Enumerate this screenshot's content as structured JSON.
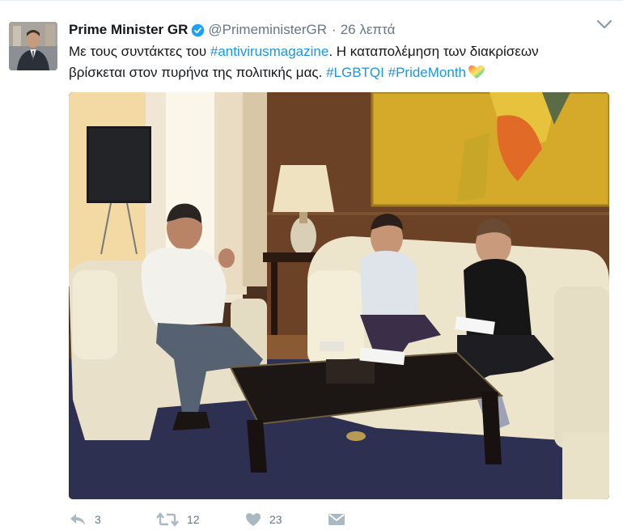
{
  "tweet": {
    "display_name": "Prime Minister GR",
    "handle": "@PrimeministerGR",
    "separator": "·",
    "time": "26 λεπτά",
    "text_line1_prefix": "Με τους συντάκτες του ",
    "text_hashtag_1": "#antivirusmagazine",
    "text_line1_suffix": ". Η καταπολέμηση των διακρίσεων",
    "text_line2_prefix": "βρίσκεται στον πυρήνα της πολιτικής μας. ",
    "text_hashtag_2": "#LGBTQI",
    "text_space": " ",
    "text_hashtag_3": "#PrideMonth",
    "emoji": "rainbow-heart-icon"
  },
  "actions": {
    "reply_count": "3",
    "retweet_count": "12",
    "like_count": "23",
    "reply_icon": "reply-icon",
    "retweet_icon": "retweet-icon",
    "like_icon": "heart-icon",
    "dm_icon": "envelope-icon"
  },
  "colors": {
    "link": "#1b95e0",
    "secondary_text": "#657786",
    "verified": "#1da1f2"
  }
}
